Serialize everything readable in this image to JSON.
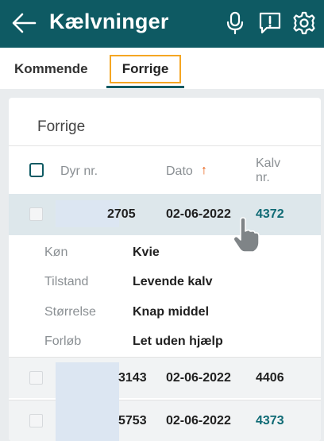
{
  "header": {
    "title": "Kælvninger",
    "background": "#0e5a63",
    "icons": [
      "back-arrow-icon",
      "microphone-icon",
      "alert-icon",
      "gear-icon"
    ]
  },
  "tabs": [
    {
      "label": "Kommende",
      "active": false
    },
    {
      "label": "Forrige",
      "active": true
    }
  ],
  "list": {
    "title": "Forrige",
    "columns": {
      "dyr": "Dyr nr.",
      "dato": "Dato",
      "kalv": "Kalv nr."
    },
    "sort": {
      "column": "Dato",
      "direction": "ascending",
      "icon": "arrow-up-icon",
      "color": "#e8590c"
    },
    "rows": [
      {
        "dyr": "2705",
        "dato": "02-06-2022",
        "kalv": "4372",
        "kalv_is_link": true,
        "expanded": true
      },
      {
        "dyr": "3143",
        "dato": "02-06-2022",
        "kalv": "4406",
        "kalv_is_link": false,
        "expanded": false
      },
      {
        "dyr": "5753",
        "dato": "02-06-2022",
        "kalv": "4373",
        "kalv_is_link": true,
        "expanded": false
      }
    ],
    "details": [
      {
        "label": "Køn",
        "value": "Kvie"
      },
      {
        "label": "Tilstand",
        "value": "Levende kalv"
      },
      {
        "label": "Størrelse",
        "value": "Knap middel"
      },
      {
        "label": "Forløb",
        "value": "Let uden hjælp"
      }
    ]
  },
  "colors": {
    "accent": "#0e5a63",
    "link": "#0e6a74",
    "tab_focus": "#f5a623",
    "selected_row": "#dde7eb"
  }
}
